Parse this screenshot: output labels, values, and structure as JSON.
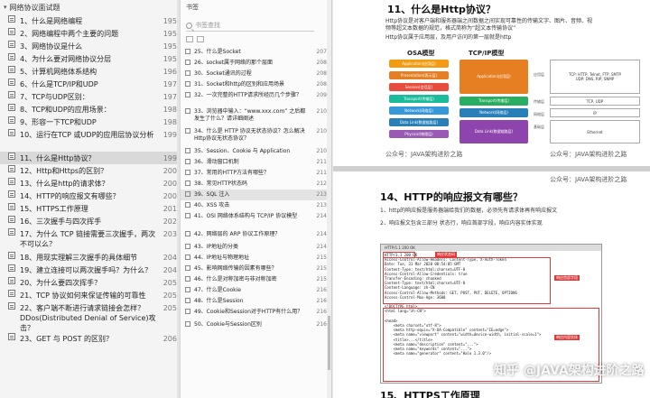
{
  "left_panel": {
    "title": "网络协议面试题",
    "items": [
      {
        "label": "1、什么是网络编程",
        "page": "195",
        "selected": false
      },
      {
        "label": "2、网络编程中两个主要的问题",
        "page": "195",
        "selected": false
      },
      {
        "label": "3、网络协议是什么",
        "page": "195",
        "selected": false
      },
      {
        "label": "4、为什么要对网络协议分层",
        "page": "195",
        "selected": false
      },
      {
        "label": "5、计算机网络体系结构",
        "page": "196",
        "selected": false
      },
      {
        "label": "6、什么是TCP/IP和UDP",
        "page": "197",
        "selected": false
      },
      {
        "label": "7、TCP与UDP区别：",
        "page": "197",
        "selected": false
      },
      {
        "label": "8、TCP和UDP的应用场景：",
        "page": "198",
        "selected": false
      },
      {
        "label": "9、形容一下TCP和UDP",
        "page": "198",
        "selected": false
      },
      {
        "label": "10、运行在TCP 或UDP的应用层协议分析",
        "page": "199",
        "selected": false
      },
      {
        "label": "11、什么是Http协议？",
        "page": "199",
        "selected": true
      },
      {
        "label": "12、Http和Https的区别？",
        "page": "200",
        "selected": false
      },
      {
        "label": "13、什么是http的请求体？",
        "page": "200",
        "selected": false
      },
      {
        "label": "14、HTTP的响应报文有哪些？",
        "page": "200",
        "selected": false
      },
      {
        "label": "15、HTTPS工作原理",
        "page": "201",
        "selected": false
      },
      {
        "label": "16、三次握手与四次挥手",
        "page": "202",
        "selected": false
      },
      {
        "label": "17、为什么 TCP 链接需要三次握手，两次不可以么？",
        "page": "203",
        "selected": false
      },
      {
        "label": "18、用现实理解三次握手的具体细节",
        "page": "204",
        "selected": false
      },
      {
        "label": "19、建立连接可以两次握手吗？为什么？",
        "page": "204",
        "selected": false
      },
      {
        "label": "20、为什么要四次挥手？",
        "page": "205",
        "selected": false
      },
      {
        "label": "21、TCP 协议如何来保证传输的可靠性",
        "page": "205",
        "selected": false
      },
      {
        "label": "22、客户端不断进行请求链接会怎样？DDos(Distributed Denial of Service)攻击？",
        "page": "205",
        "selected": false
      },
      {
        "label": "23、GET 与 POST 的区别？",
        "page": "206",
        "selected": false
      }
    ]
  },
  "mid_panel": {
    "title": "书签",
    "search_placeholder": "书签查找",
    "items": [
      {
        "label": "25、什么是Socket",
        "page": "207",
        "selected": false
      },
      {
        "label": "26、socket属于网络的那个层面",
        "page": "208",
        "selected": false
      },
      {
        "label": "30、Socket通讯的过程",
        "page": "208",
        "selected": false
      },
      {
        "label": "31、Socket和http的区别和应用场景",
        "page": "208",
        "selected": false
      },
      {
        "label": "32、一次完整的HTTP请求所经历几个步骤？",
        "page": "209",
        "selected": false
      },
      {
        "label": "33、浏览器中输入：“www.xxx.com” 之后都发生了什么？请详细阐述",
        "page": "210",
        "selected": false
      },
      {
        "label": "34、什么是 HTTP 协议无状态协议？怎么解决Http协议无状态协议？",
        "page": "210",
        "selected": false
      },
      {
        "label": "35、Session、Cookie 与 Application",
        "page": "210",
        "selected": false
      },
      {
        "label": "36、滑动窗口机制",
        "page": "211",
        "selected": false
      },
      {
        "label": "37、常用的HTTP方法有哪些？",
        "page": "211",
        "selected": false
      },
      {
        "label": "38、常见HTTP状态码",
        "page": "212",
        "selected": false
      },
      {
        "label": "39、SQL 注入",
        "page": "213",
        "selected": true
      },
      {
        "label": "40、XSS 攻击",
        "page": "213",
        "selected": false
      },
      {
        "label": "41、OSI 网络体系结构与 TCP/IP 协议模型",
        "page": "214",
        "selected": false
      },
      {
        "label": "42、网络层的 ARP 协议工作原理？",
        "page": "214",
        "selected": false
      },
      {
        "label": "43、IP地址的分类",
        "page": "214",
        "selected": false
      },
      {
        "label": "44、IP地址与物理地址",
        "page": "215",
        "selected": false
      },
      {
        "label": "45、影响网络传输的因素有哪些？",
        "page": "215",
        "selected": false
      },
      {
        "label": "46、什么是对称加密与非对称加密",
        "page": "215",
        "selected": false
      },
      {
        "label": "47、什么是Cookie",
        "page": "216",
        "selected": false
      },
      {
        "label": "48、什么是Session",
        "page": "216",
        "selected": false
      },
      {
        "label": "49、Cookie和Session对于HTTP有什么用？",
        "page": "216",
        "selected": false
      },
      {
        "label": "50、Cookie与Session区别",
        "page": "216",
        "selected": false
      }
    ]
  },
  "doc": {
    "page1": {
      "heading": "11、什么是Http协议？",
      "bullets": [
        "Http协议是对客户端和服务器端之间数据之间实现可靠性的传输文字、图片、音频、视频等超文本数据的规范，格式简称为“超文本传输协议”",
        "Http协议属于应用层，及用户访问的第一层就是http"
      ],
      "osa_title": "OSA模型",
      "tcpip_title": "TCP/IP模型",
      "osi_layers": [
        "Application(应用层)",
        "Presentation(表示层)",
        "Session(会话层)",
        "Transport(传输层)",
        "Network(网络层)",
        "Data Link(数据链路层)",
        "Physical(物理层)"
      ],
      "tcp_layers": [
        "Application(应用层)",
        "Transport(传输层)",
        "Network(网络层)",
        "Data Link(数据链路层)"
      ],
      "side_labels": [
        "应用层",
        "传输层",
        "网络层",
        "基础层"
      ],
      "protocols": [
        "TCP: HTTP, Telnet, FTP, SMTP\nUDP: DNS, RIP, SNMP",
        "TCP, UDP",
        "IP",
        "Ethernet"
      ],
      "footer_left": "公众号：JAVA架构进阶之路",
      "footer_right": "公众号：JAVA架构进阶之路"
    },
    "page2": {
      "footer_top": "公众号：JAVA架构进阶之路",
      "heading": "14、HTTP的响应报文有哪些？",
      "bullets": [
        "1、http的响应报是服务器端给我们的数据，必须先有请求体再有响应报文",
        "2、响应报文包含三部分 状态行，响应首部字段，响应内容实体实现"
      ],
      "screenshot_title": "HTTP/1.1 200 OK",
      "code_lines": [
        "HTTP/1.1 200 OK",
        "Access-Control-Allow-Headers: Content-Type, X-Auth-Token",
        "Date: Tue, 31 Mar 2020 08:54:05 GMT",
        "Content-Type: text/html;charset=UTF-8",
        "Access-Control-Allow-Credentials: true",
        "Transfer-Encoding: chunked",
        "Content-Type: text/html;charset=UTF-8",
        "Content-Language: zh-CN",
        "Access-Control-Allow-Methods: GET, POST, PUT, DELETE, OPTIONS",
        "Access-Control-Max-Age: 3600",
        "",
        "<!DOCTYPE html>",
        "<html lang=\"zh-CN\">",
        "",
        "<head>",
        "    <meta charset=\"utf-8\">",
        "    <meta http-equiv=\"X-UA-Compatible\" content=\"IE=edge\">",
        "    <meta name=\"viewport\" content=\"width=device-width, initial-scale=1\">",
        "    <title>...</title>",
        "    <meta name=\"description\" content=\"...\">",
        "    <meta name=\"keywords\" content=\"...\">",
        "    <meta name=\"generator\" content=\"Halo 1.3.0\"/>"
      ],
      "tags": [
        "响应状态码",
        "响应首部字段",
        "响应内容实体"
      ],
      "next_heading": "15、HTTPS工作原理"
    },
    "watermark": "知乎 @JAVA架构进阶之路"
  },
  "colors": {
    "osi": [
      "#f39c12",
      "#e67e22",
      "#e74c3c",
      "#1abc9c",
      "#3498db",
      "#2980b9",
      "#9b59b6"
    ],
    "tcp": [
      "#e67e22",
      "#27ae60",
      "#2980b9",
      "#8e44ad"
    ]
  }
}
